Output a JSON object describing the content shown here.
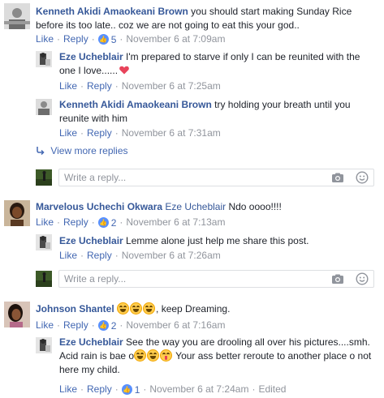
{
  "thread1": {
    "main": {
      "author": "Kenneth Akidi Amaokeani Brown",
      "text": " you should start making Sunday Rice before its too late.. coz we are not going to eat this your god..",
      "actions": {
        "like": "Like",
        "reply": "Reply"
      },
      "like_count": "5",
      "timestamp": "November 6 at 7:09am"
    },
    "replies": [
      {
        "author": "Eze Ucheblair",
        "text": " I'm prepared to starve if only I can be reunited with the one I love......",
        "actions": {
          "like": "Like",
          "reply": "Reply"
        },
        "timestamp": "November 6 at 7:25am"
      },
      {
        "author": "Kenneth Akidi Amaokeani Brown",
        "text": " try holding your breath until you reunite with him",
        "actions": {
          "like": "Like",
          "reply": "Reply"
        },
        "timestamp": "November 6 at 7:31am"
      }
    ],
    "view_more": "View more replies",
    "reply_placeholder": "Write a reply..."
  },
  "thread2": {
    "main": {
      "author": "Marvelous Uchechi Okwara",
      "tag": "Eze Ucheblair",
      "text": " Ndo oooo!!!!",
      "actions": {
        "like": "Like",
        "reply": "Reply"
      },
      "like_count": "2",
      "timestamp": "November 6 at 7:13am"
    },
    "replies": [
      {
        "author": "Eze Ucheblair",
        "text": " Lemme alone just help me share this post.",
        "actions": {
          "like": "Like",
          "reply": "Reply"
        },
        "timestamp": "November 6 at 7:26am"
      }
    ],
    "reply_placeholder": "Write a reply..."
  },
  "thread3": {
    "main": {
      "author": "Johnson Shantel",
      "text": ", keep Dreaming.",
      "actions": {
        "like": "Like",
        "reply": "Reply"
      },
      "like_count": "2",
      "timestamp": "November 6 at 7:16am"
    },
    "replies": [
      {
        "author": "Eze Ucheblair",
        "text_part1": " See the way you are drooling all over his pictures....smh. Acid rain is bae o",
        "text_part2": " Your ass better reroute to another place o not here my child.",
        "actions": {
          "like": "Like",
          "reply": "Reply"
        },
        "like_count": "1",
        "timestamp": "November 6 at 7:24am",
        "edited": "Edited"
      }
    ]
  },
  "colors": {
    "link": "#365899",
    "action": "#4267b2",
    "meta": "#90949c",
    "like_badge": "#5890ff"
  },
  "icons": [
    "camera-icon",
    "smiley-icon",
    "like-thumb-icon",
    "reply-arrow-icon",
    "heart-icon"
  ]
}
